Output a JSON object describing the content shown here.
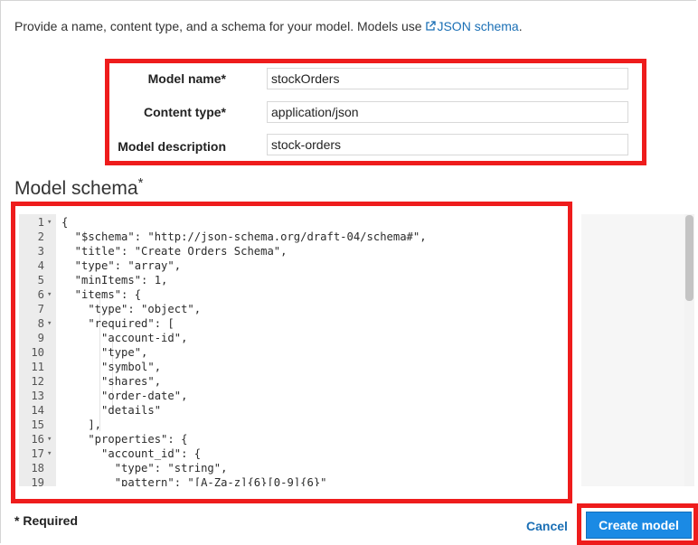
{
  "intro": {
    "text": "Provide a name, content type, and a schema for your model. Models use ",
    "link": "JSON schema",
    "suffix": "."
  },
  "form": {
    "model_name": {
      "label": "Model name*",
      "value": "stockOrders"
    },
    "content_type": {
      "label": "Content type*",
      "value": "application/json"
    },
    "model_description": {
      "label": "Model description",
      "value": "stock-orders"
    }
  },
  "schema": {
    "title": "Model schema",
    "title_marker": "*",
    "lines": [
      {
        "n": "1",
        "fold": true,
        "text": "{"
      },
      {
        "n": "2",
        "fold": false,
        "text": "  \"$schema\": \"http://json-schema.org/draft-04/schema#\","
      },
      {
        "n": "3",
        "fold": false,
        "text": "  \"title\": \"Create Orders Schema\","
      },
      {
        "n": "4",
        "fold": false,
        "text": "  \"type\": \"array\","
      },
      {
        "n": "5",
        "fold": false,
        "text": "  \"minItems\": 1,"
      },
      {
        "n": "6",
        "fold": true,
        "text": "  \"items\": {"
      },
      {
        "n": "7",
        "fold": false,
        "text": "    \"type\": \"object\","
      },
      {
        "n": "8",
        "fold": true,
        "text": "    \"required\": ["
      },
      {
        "n": "9",
        "fold": false,
        "text": "      \"account-id\","
      },
      {
        "n": "10",
        "fold": false,
        "text": "      \"type\","
      },
      {
        "n": "11",
        "fold": false,
        "text": "      \"symbol\","
      },
      {
        "n": "12",
        "fold": false,
        "text": "      \"shares\","
      },
      {
        "n": "13",
        "fold": false,
        "text": "      \"order-date\","
      },
      {
        "n": "14",
        "fold": false,
        "text": "      \"details\""
      },
      {
        "n": "15",
        "fold": false,
        "text": "    ],"
      },
      {
        "n": "16",
        "fold": true,
        "text": "    \"properties\": {"
      },
      {
        "n": "17",
        "fold": true,
        "text": "      \"account_id\": {"
      },
      {
        "n": "18",
        "fold": false,
        "text": "        \"type\": \"string\","
      },
      {
        "n": "19",
        "fold": false,
        "text": "        \"pattern\": \"[A-Za-z]{6}[0-9]{6}\""
      }
    ]
  },
  "footer": {
    "required_note": "* Required",
    "cancel": "Cancel",
    "create": "Create model"
  },
  "colors": {
    "highlight": "#ee1c1c",
    "link": "#1a6fb5",
    "primary_button": "#1b8ae4"
  }
}
